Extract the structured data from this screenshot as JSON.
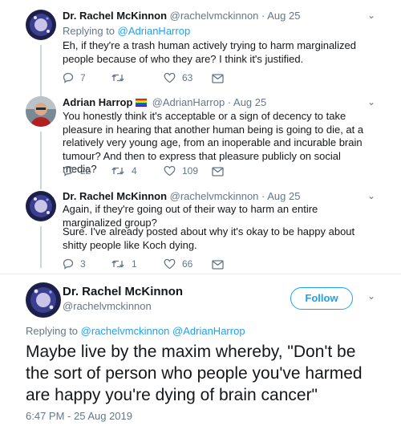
{
  "tweets": [
    {
      "name": "Dr. Rachel McKinnon",
      "handle": "@rachelvmckinnon",
      "date": "· Aug 25",
      "replying_prefix": "Replying to ",
      "replying_user": "@AdrianHarrop",
      "text": "Eh, if they're a trash human actively trying to harm marginalized people because of who they are? I think it's justified.",
      "replies": "7",
      "retweets": "",
      "likes": "63"
    },
    {
      "name": "Adrian Harrop",
      "handle": "@AdrianHarrop",
      "date": "· Aug 25",
      "text": "You honestly think it's acceptable or a sign of decency to take pleasure in hearing that another human being is going to die, at a relatively very young age, from an inoperable and incurable brain tumour? And then to express that pleasure publicly on social media?",
      "replies": "22",
      "retweets": "4",
      "likes": "109"
    },
    {
      "name": "Dr. Rachel McKinnon",
      "handle": "@rachelvmckinnon",
      "date": "· Aug 25",
      "text_line1": "Again, if they're going out of their way to harm an entire marginalized group?",
      "text_line2": "Sure. I've already posted about why it's okay to be happy about shitty people like Koch dying.",
      "replies": "3",
      "retweets": "1",
      "likes": "66"
    }
  ],
  "main_tweet": {
    "name": "Dr. Rachel McKinnon",
    "handle": "@rachelvmckinnon",
    "follow_label": "Follow",
    "replying_prefix": "Replying to ",
    "replying_user1": "@rachelvmckinnon",
    "replying_user2": "@AdrianHarrop",
    "text": "Maybe live by the maxim whereby, \"Don't be the sort of person who people you've harmed are happy you're dying of brain cancer\"",
    "timestamp": "6:47 PM - 25 Aug 2019"
  },
  "colors": {
    "accent": "#1da1f2",
    "muted": "#657786",
    "thread_line": "#ccd6dd"
  }
}
